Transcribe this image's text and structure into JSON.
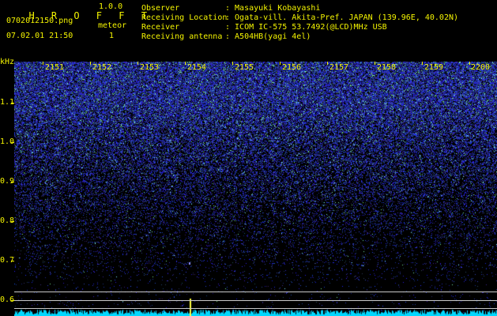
{
  "app": {
    "name": "H R O F F T",
    "version": "1.0.0",
    "filename": "0702012150.png",
    "datetime": "07.02.01 21:50",
    "mode_label": "meteor",
    "count": "1"
  },
  "info": [
    {
      "key": "Observer",
      "value": ": Masayuki Kobayashi"
    },
    {
      "key": "Receiving Location",
      "value": ": Ogata-vill. Akita-Pref. JAPAN (139.96E, 40.02N)"
    },
    {
      "key": "Receiver",
      "value": ": ICOM IC-575 53.7492(@LCD)MHz USB"
    },
    {
      "key": "Receiving antenna",
      "value": ": A504HB(yagi 4el)"
    }
  ],
  "axes": {
    "y_unit": "kHz",
    "y_labels": [
      "1.1",
      "1.0",
      "0.9",
      "0.8",
      "0.7",
      "0.6"
    ],
    "x_labels": [
      "2151",
      "2152",
      "2153",
      "2154",
      "2155",
      "2156",
      "2157",
      "2158",
      "2159",
      "2200"
    ]
  },
  "colors": {
    "text": "#f4f400",
    "background": "#000000",
    "noise_blue": "#3030ff",
    "noise_cyan": "#00e0ff",
    "ref_lines": "#c9c9c9"
  }
}
